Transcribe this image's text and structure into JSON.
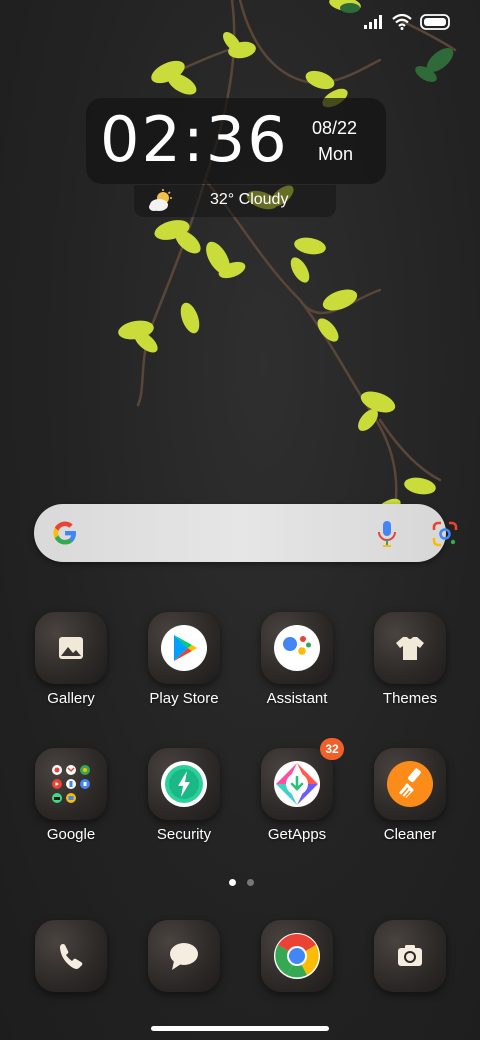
{
  "status_bar": {
    "icons": [
      "signal-icon",
      "wifi-icon",
      "battery-icon"
    ]
  },
  "clock_widget": {
    "time": "02:36",
    "date": "08/22",
    "day": "Mon"
  },
  "weather_widget": {
    "icon": "partly-cloudy-icon",
    "text": "32° Cloudy"
  },
  "search_bar": {
    "icons": [
      "google-g-icon",
      "microphone-icon",
      "google-lens-icon"
    ]
  },
  "apps": {
    "row1": [
      {
        "label": "Gallery",
        "icon": "gallery-icon"
      },
      {
        "label": "Play Store",
        "icon": "play-store-icon"
      },
      {
        "label": "Assistant",
        "icon": "assistant-icon"
      },
      {
        "label": "Themes",
        "icon": "themes-icon"
      }
    ],
    "row2": [
      {
        "label": "Google",
        "icon": "google-folder-icon"
      },
      {
        "label": "Security",
        "icon": "security-icon"
      },
      {
        "label": "GetApps",
        "icon": "getapps-icon",
        "badge": "32"
      },
      {
        "label": "Cleaner",
        "icon": "cleaner-icon"
      }
    ]
  },
  "page_indicator": {
    "pages": 2,
    "active": 1
  },
  "dock": [
    {
      "icon": "phone-icon"
    },
    {
      "icon": "messages-icon"
    },
    {
      "icon": "chrome-icon"
    },
    {
      "icon": "camera-icon"
    }
  ],
  "colors": {
    "background": "#242424",
    "badge": "#f0602a",
    "leaf": "#c9dc3a"
  }
}
